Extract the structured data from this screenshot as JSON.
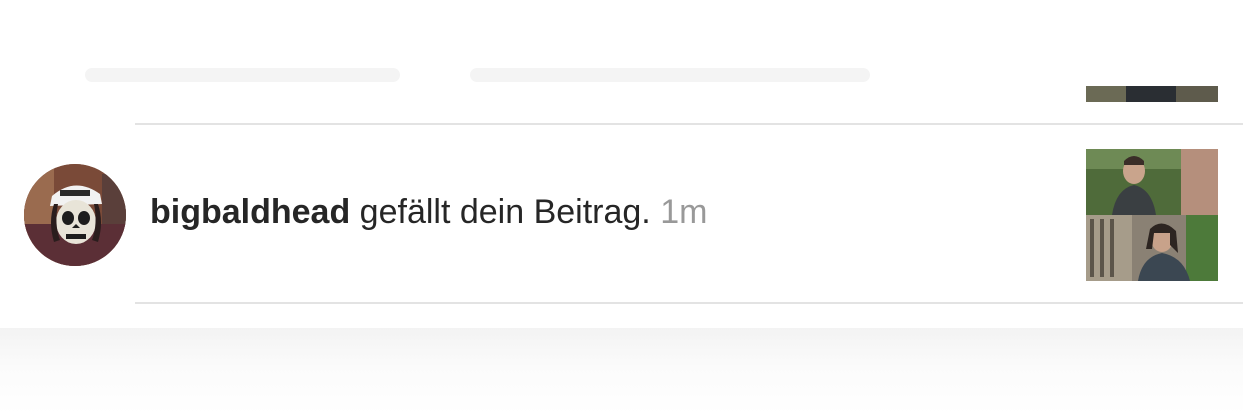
{
  "notification": {
    "username": "bigbaldhead",
    "action": " gefällt dein Beitrag. ",
    "timestamp": "1m",
    "avatar_icon": "profile-avatar-skull-face",
    "post_thumbnail_icon": "liked-post-thumbnail"
  },
  "colors": {
    "text": "#262626",
    "timestamp": "#999999",
    "divider": "#e3e3e3"
  }
}
